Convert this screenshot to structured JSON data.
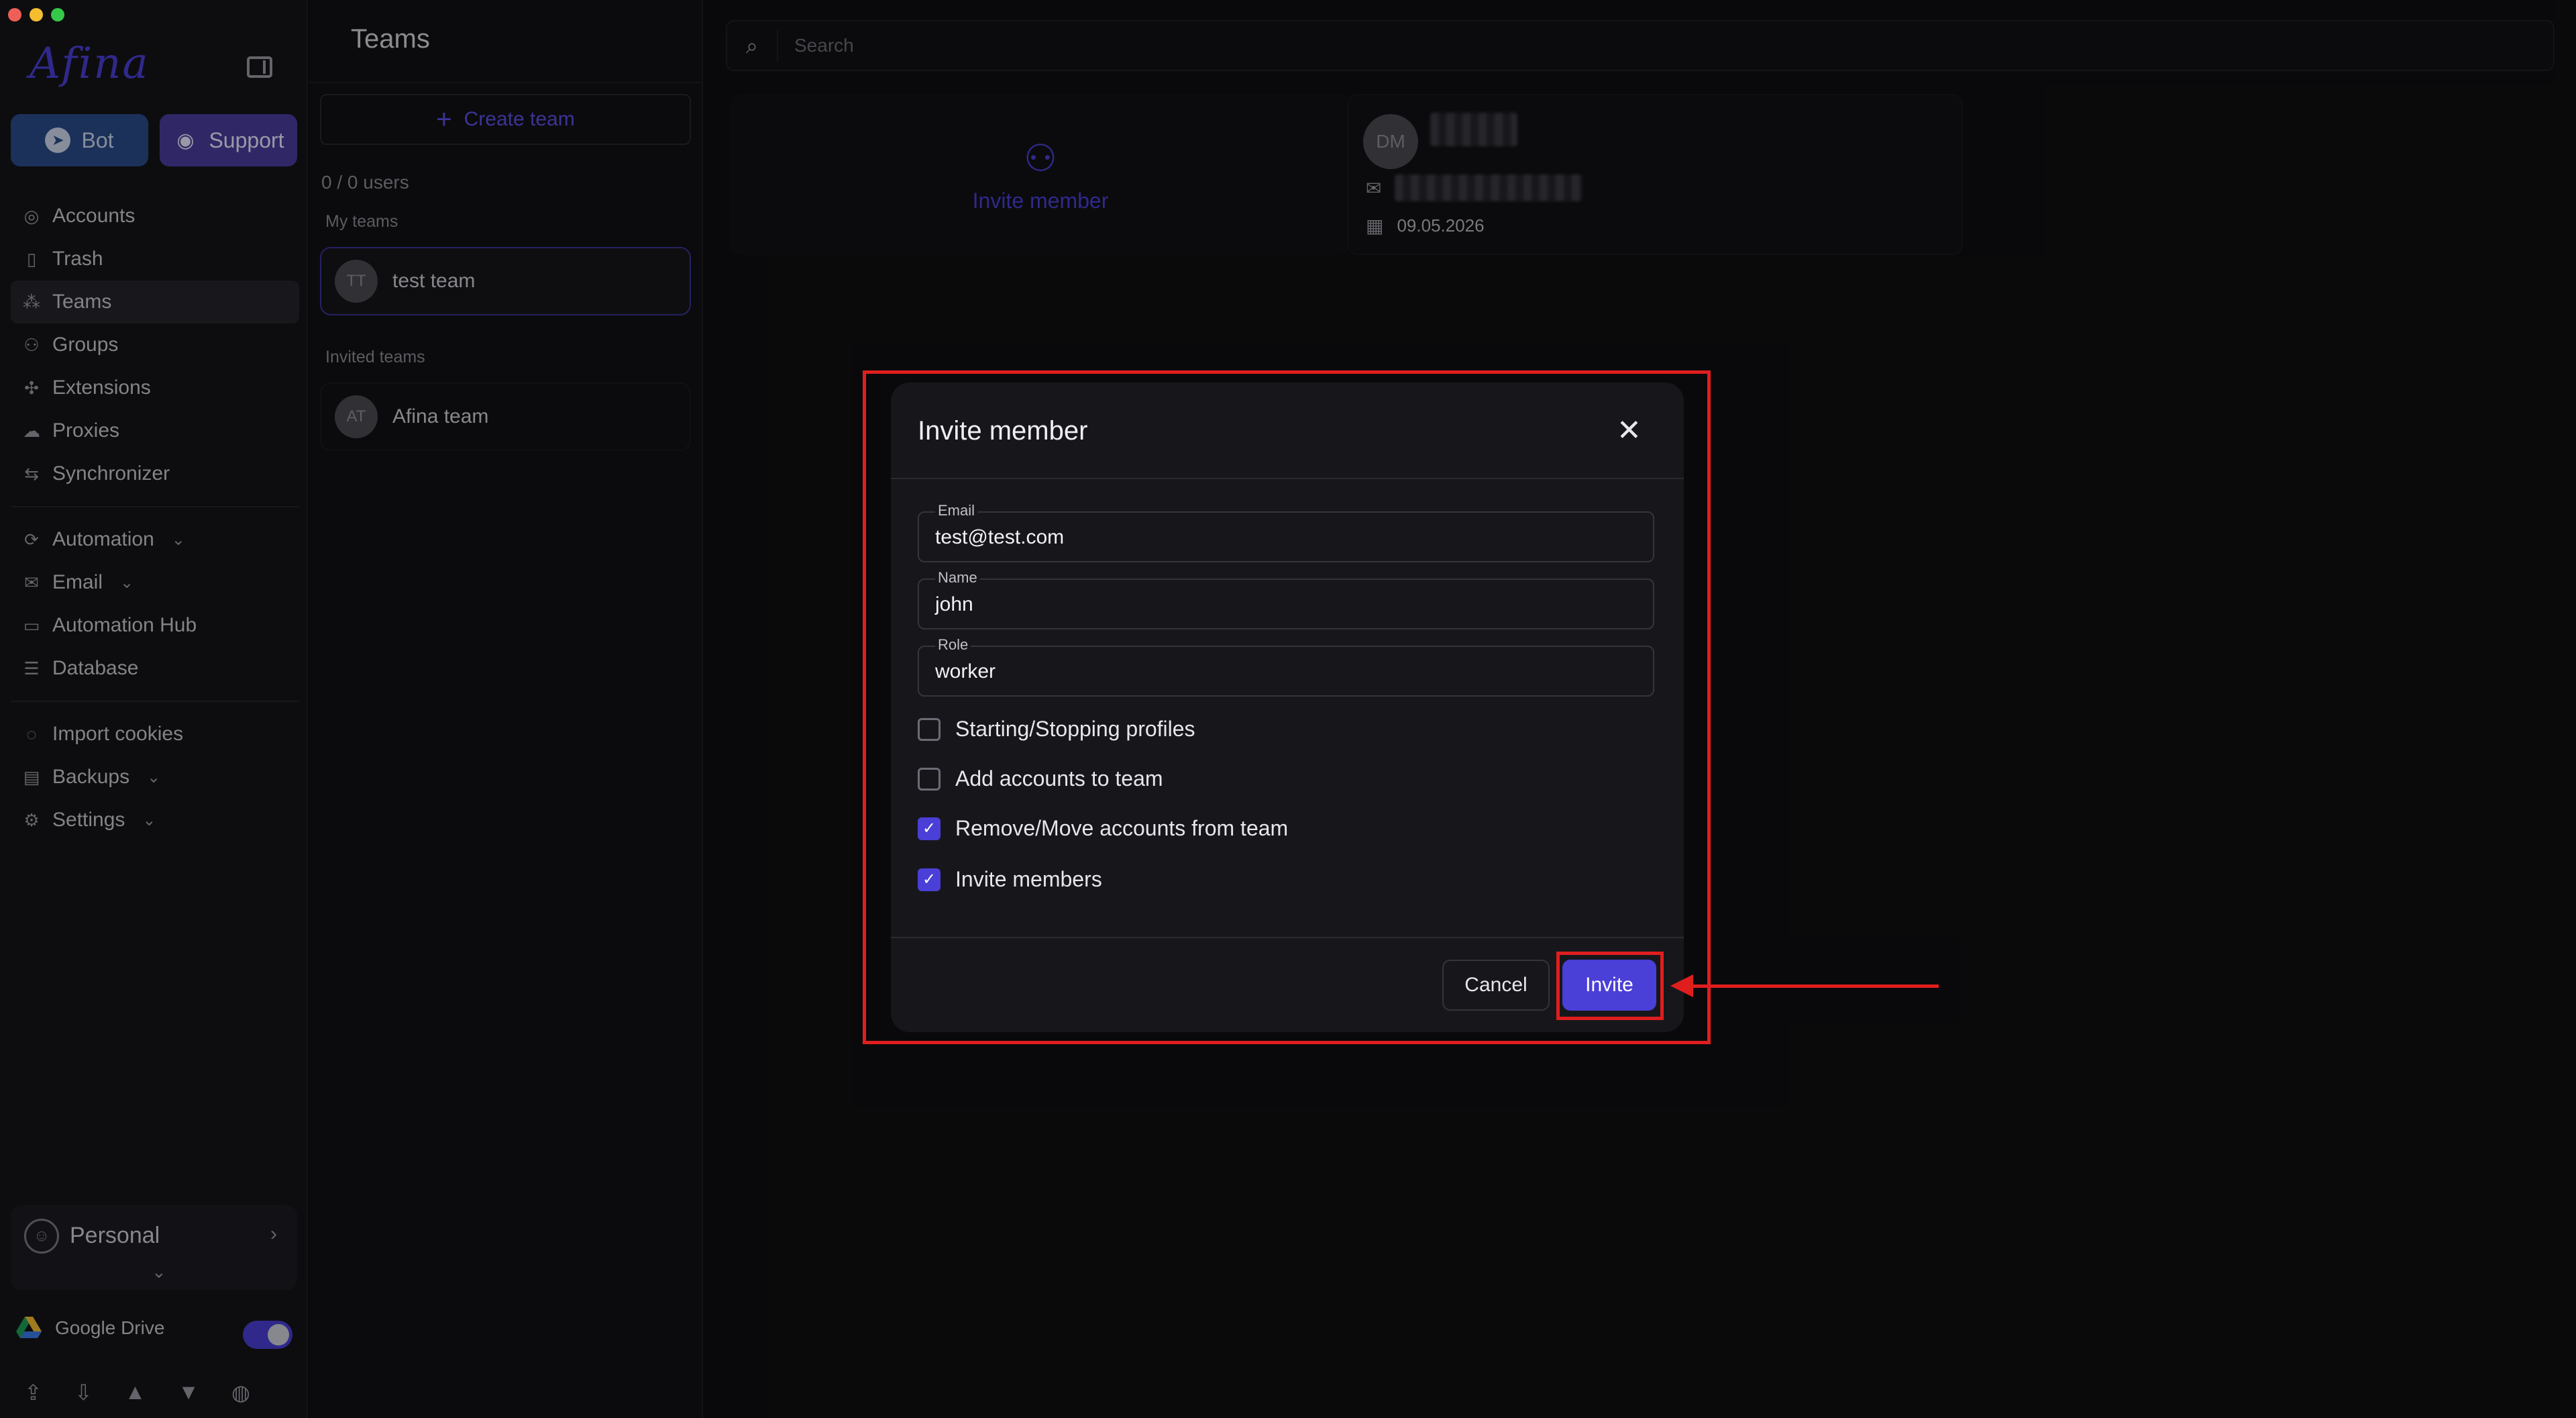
{
  "sidebar": {
    "logo": "Afina",
    "bot_label": "Bot",
    "support_label": "Support",
    "nav_main": [
      {
        "label": "Accounts",
        "icon": "account-circle-icon"
      },
      {
        "label": "Trash",
        "icon": "trash-icon"
      },
      {
        "label": "Teams",
        "icon": "teams-icon",
        "active": true
      },
      {
        "label": "Groups",
        "icon": "groups-icon"
      },
      {
        "label": "Extensions",
        "icon": "puzzle-icon"
      },
      {
        "label": "Proxies",
        "icon": "cloud-icon"
      },
      {
        "label": "Synchronizer",
        "icon": "sync-icon"
      }
    ],
    "nav_tools": [
      {
        "label": "Automation",
        "icon": "automation-icon",
        "expandable": true
      },
      {
        "label": "Email",
        "icon": "mail-icon",
        "expandable": true
      },
      {
        "label": "Automation Hub",
        "icon": "laptop-icon"
      },
      {
        "label": "Database",
        "icon": "database-icon"
      }
    ],
    "nav_misc": [
      {
        "label": "Import cookies",
        "icon": "cookie-icon"
      },
      {
        "label": "Backups",
        "icon": "backup-icon",
        "expandable": true
      },
      {
        "label": "Settings",
        "icon": "gear-icon",
        "expandable": true
      }
    ],
    "workspace_label": "Personal",
    "google_drive_label": "Google Drive",
    "google_drive_enabled": true
  },
  "teams": {
    "title": "Teams",
    "create_label": "Create team",
    "users_count": "0 / 0 users",
    "my_teams_label": "My teams",
    "my_teams": [
      {
        "initials": "TT",
        "name": "test team"
      }
    ],
    "invited_teams_label": "Invited teams",
    "invited_teams": [
      {
        "initials": "AT",
        "name": "Afina team"
      }
    ]
  },
  "main": {
    "search_placeholder": "Search",
    "invite_member_label": "Invite member",
    "member": {
      "initials": "DM",
      "date": "09.05.2026"
    }
  },
  "modal": {
    "title": "Invite member",
    "fields": {
      "email": {
        "label": "Email",
        "value": "test@test.com"
      },
      "name": {
        "label": "Name",
        "value": "john"
      },
      "role": {
        "label": "Role",
        "value": "worker"
      }
    },
    "permissions": [
      {
        "label": "Starting/Stopping profiles",
        "checked": false
      },
      {
        "label": "Add accounts to team",
        "checked": false
      },
      {
        "label": "Remove/Move accounts from team",
        "checked": true
      },
      {
        "label": "Invite members",
        "checked": true
      }
    ],
    "cancel_label": "Cancel",
    "invite_label": "Invite"
  },
  "colors": {
    "accent": "#4a3fd6",
    "annotation": "#e01e1e"
  }
}
